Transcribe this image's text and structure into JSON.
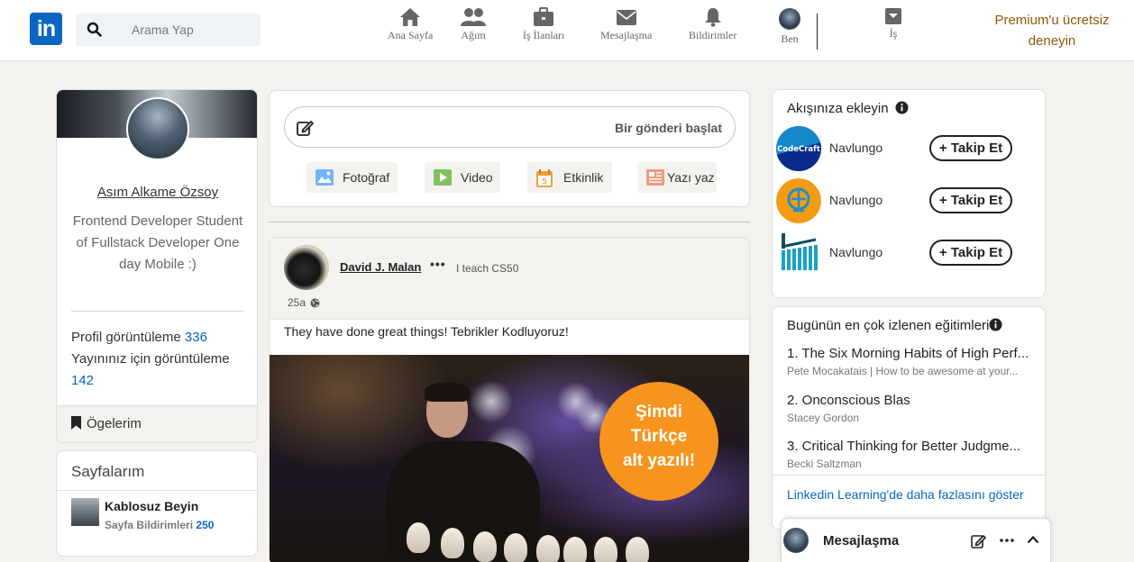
{
  "header": {
    "logo_text": "in",
    "search_placeholder": "Arama Yap",
    "nav": [
      {
        "label": "Ana Sayfa",
        "icon": "home-icon"
      },
      {
        "label": "Ağım",
        "icon": "network-icon"
      },
      {
        "label": "İş İlanları",
        "icon": "briefcase-icon"
      },
      {
        "label": "Mesajlaşma",
        "icon": "envelope-icon"
      },
      {
        "label": "Bildirimler",
        "icon": "bell-icon"
      },
      {
        "label": "Ben",
        "icon": "avatar"
      },
      {
        "label": "İş",
        "icon": "grid-icon"
      }
    ],
    "premium_line1": "Premium'u ücretsiz",
    "premium_line2": "deneyin"
  },
  "profile": {
    "name": "Asım Alkame Özsoy",
    "headline": "Frontend Developer Student of Fullstack Developer One day Mobile :)",
    "stats": {
      "views_label": "Profil görüntüleme",
      "views_value": "336",
      "post_views_label": "Yayınınız için görüntüleme",
      "post_views_value": "142"
    },
    "items_label": "Ögelerim"
  },
  "pages": {
    "title": "Sayfalarım",
    "entry": {
      "name": "Kablosuz Beyin",
      "sub_label": "Sayfa Bildirimleri",
      "sub_value": "250"
    }
  },
  "share": {
    "placeholder": "Bir gönderi başlat",
    "actions": [
      {
        "label": "Fotoğraf",
        "icon": "photo-icon"
      },
      {
        "label": "Video",
        "icon": "video-icon"
      },
      {
        "label": "Etkinlik",
        "icon": "calendar-icon"
      },
      {
        "label": "Yazı yaz",
        "icon": "article-icon"
      }
    ]
  },
  "post": {
    "author": "David J. Malan",
    "more": "•••",
    "subtitle": "I teach CS50",
    "time": "25a",
    "body": "They have done great things! Tebrikler Kodluyoruz!",
    "promo_lines": [
      "Şimdi",
      "Türkçe",
      "alt yazılı!"
    ]
  },
  "follow": {
    "title": "Akışınıza ekleyin",
    "button_label": "+ Takip Et",
    "rows": [
      {
        "name": "Navlungo",
        "logo": "codecraft",
        "logo_text": "CodeCraft"
      },
      {
        "name": "Navlungo",
        "logo": "orange-circle"
      },
      {
        "name": "Navlungo",
        "logo": "teal-bars"
      }
    ]
  },
  "learning": {
    "title": "Bugünün en çok izlenen eğitimleri",
    "courses": [
      {
        "title": "1. The Six Morning Habits of High Perf...",
        "author": "Pete Mocakatais | How to be awesome at your..."
      },
      {
        "title": "2. Onconscious Blas",
        "author": "Stacey Gordon"
      },
      {
        "title": "3. Critical Thinking for Better Judgme...",
        "author": "Becki Saltzman"
      }
    ],
    "more_link": "Linkedin Learning'de daha fazlasını göster"
  },
  "messaging": {
    "title": "Mesajlaşma"
  },
  "colors": {
    "brand": "#0a66c2",
    "premium": "#915907",
    "promo": "#f7941d"
  }
}
